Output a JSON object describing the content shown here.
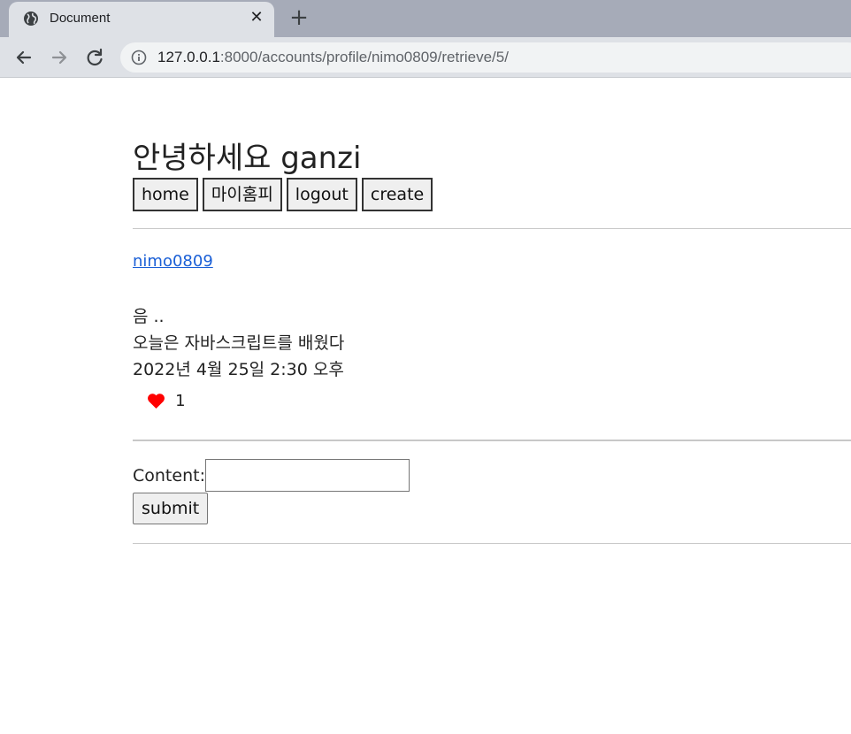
{
  "browser": {
    "tab_title": "Document",
    "tab_close": "✕",
    "new_tab": "+",
    "url_host": "127.0.0.1",
    "url_rest": ":8000/accounts/profile/nimo0809/retrieve/5/"
  },
  "page": {
    "greeting": "안녕하세요 ganzi",
    "menu": {
      "home": "home",
      "my_homepage": "마이홈피",
      "logout": "logout",
      "create": "create"
    },
    "post": {
      "author": "nimo0809",
      "line1": "음 ..",
      "line2": "오늘은 자바스크립트를 배웠다",
      "datetime": "2022년 4월 25일 2:30 오후",
      "like_count": "1",
      "like_color": "#ff0000"
    },
    "form": {
      "content_label": "Content:",
      "content_value": "",
      "submit_label": "submit"
    }
  }
}
